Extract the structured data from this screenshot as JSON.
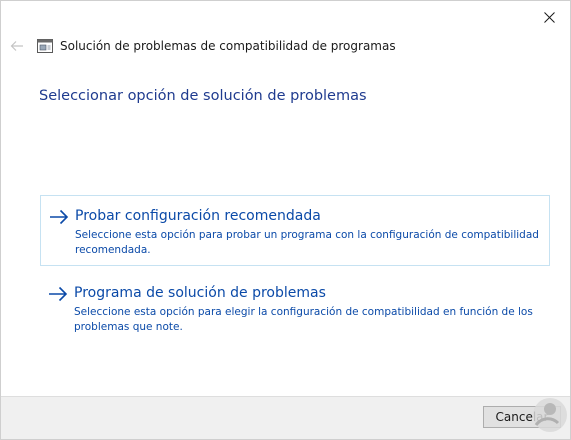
{
  "window": {
    "title": "Solución de problemas de compatibilidad de programas",
    "close_icon": "close-icon",
    "back_icon": "back-arrow-icon"
  },
  "page": {
    "heading": "Seleccionar opción de solución de problemas"
  },
  "options": [
    {
      "title": "Probar configuración recomendada",
      "description": "Seleccione esta opción para probar un programa con la configuración de compatibilidad recomendada.",
      "icon": "arrow-right-icon",
      "selected": true
    },
    {
      "title": "Programa de solución de problemas",
      "description": "Seleccione esta opción para elegir la configuración de compatibilidad en función de los problemas que note.",
      "icon": "arrow-right-icon",
      "selected": false
    }
  ],
  "footer": {
    "cancel_label": "Cancelar"
  },
  "colors": {
    "heading": "#1f3b8f",
    "link": "#0b4aa8",
    "selected_border": "#c6e2f2",
    "footer_bg": "#f0f0f0"
  }
}
